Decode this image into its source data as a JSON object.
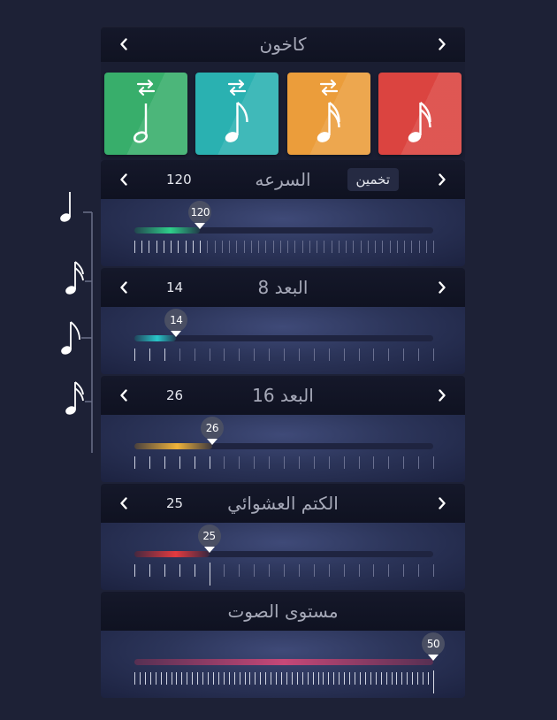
{
  "header": {
    "title": "كاخون"
  },
  "types": [
    {
      "name": "whole-note-green",
      "color": "#38ae6b",
      "swap": true,
      "note": "quarter"
    },
    {
      "name": "eighth-note-teal",
      "color": "#2ab1b1",
      "swap": true,
      "note": "eighth"
    },
    {
      "name": "sixteenth-note-orange",
      "color": "#eb9d3b",
      "swap": true,
      "note": "sixteenth"
    },
    {
      "name": "sixteenth-note-red",
      "color": "#db4440",
      "swap": false,
      "note": "sixteenth"
    }
  ],
  "sections": {
    "tempo": {
      "title": "السرعه",
      "value": "120",
      "guess_label": "تخمين",
      "handle": "120",
      "level": 0.22,
      "color": "#2fcf8a"
    },
    "eighth": {
      "title": "البعد 8",
      "value": "14",
      "handle": "14",
      "level": 0.14,
      "color": "#29c6c9"
    },
    "sixteenth": {
      "title": "البعد 16",
      "value": "26",
      "handle": "26",
      "level": 0.26,
      "color": "#f0b33a"
    },
    "mute": {
      "title": "الكتم العشوائي",
      "value": "25",
      "handle": "25",
      "level": 0.25,
      "color": "#e33a3f"
    },
    "volume": {
      "title": "مستوى الصوت",
      "handle": "50",
      "level": 1.0,
      "color": "#c64878"
    }
  },
  "colors": {
    "background": "#1d2136",
    "panel": "#2c355a"
  }
}
